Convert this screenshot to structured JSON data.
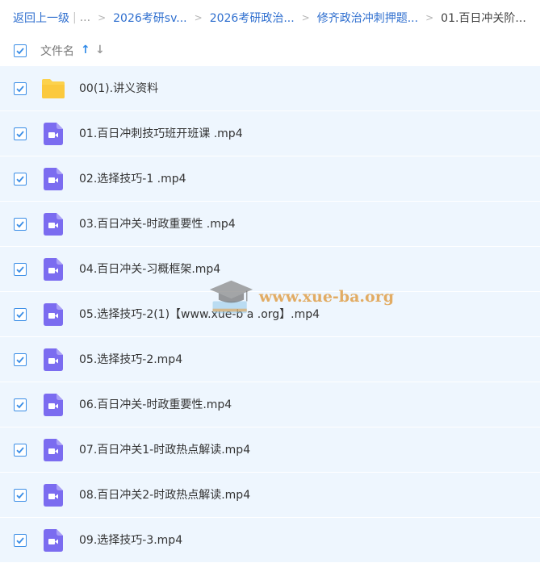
{
  "breadcrumb": {
    "back_label": "返回上一级",
    "pipe": "|",
    "ellipsis": "...",
    "separator": ">",
    "items": [
      "2026考研sv...",
      "2026考研政治...",
      "修齐政治冲刺押题...",
      "01.百日冲关阶..."
    ]
  },
  "header": {
    "column_label": "文件名",
    "sort_up": "↑",
    "sort_down": "↓"
  },
  "files": [
    {
      "name": "00(1).讲义资料",
      "type": "folder",
      "checked": true
    },
    {
      "name": "01.百日冲刺技巧班开班课 .mp4",
      "type": "video",
      "checked": true
    },
    {
      "name": "02.选择技巧-1 .mp4",
      "type": "video",
      "checked": true
    },
    {
      "name": "03.百日冲关-时政重要性 .mp4",
      "type": "video",
      "checked": true
    },
    {
      "name": "04.百日冲关-习概框架.mp4",
      "type": "video",
      "checked": true
    },
    {
      "name": "05.选择技巧-2(1)【www.xue-b a .org】.mp4",
      "type": "video",
      "checked": true
    },
    {
      "name": "05.选择技巧-2.mp4",
      "type": "video",
      "checked": true
    },
    {
      "name": "06.百日冲关-时政重要性.mp4",
      "type": "video",
      "checked": true
    },
    {
      "name": "07.百日冲关1-时政热点解读.mp4",
      "type": "video",
      "checked": true
    },
    {
      "name": "08.百日冲关2-时政热点解读.mp4",
      "type": "video",
      "checked": true
    },
    {
      "name": "09.选择技巧-3.mp4",
      "type": "video",
      "checked": true
    }
  ],
  "watermark": {
    "text": "www.xue-ba.org"
  },
  "icons": {
    "folder": "folder-icon",
    "video": "video-file-icon",
    "check": "checkbox-check-icon",
    "watermark": "graduation-cap-icon"
  },
  "colors": {
    "accent": "#2f6fcf",
    "row_bg": "#eef6fe",
    "checkbox": "#3b8ee6",
    "video_icon": "#7b6cf0",
    "folder_icon": "#fcd24d",
    "watermark": "#e0a04a"
  }
}
